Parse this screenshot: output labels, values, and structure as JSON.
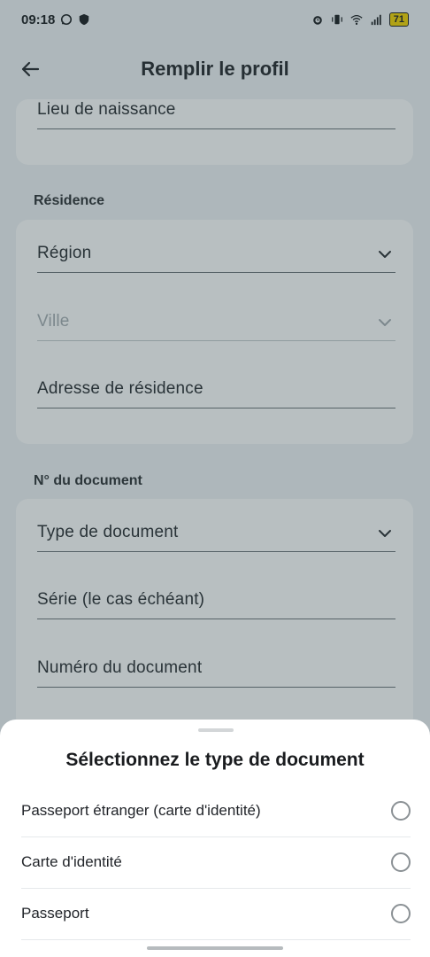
{
  "status_bar": {
    "time": "09:18",
    "battery": "71"
  },
  "app_bar": {
    "title": "Remplir le profil"
  },
  "form": {
    "birthplace_label": "Lieu de naissance",
    "residence_section": "Résidence",
    "region_label": "Région",
    "city_label": "Ville",
    "address_label": "Adresse de résidence",
    "document_section": "N° du document",
    "doc_type_label": "Type de document",
    "series_label": "Série (le cas échéant)",
    "doc_number_label": "Numéro du document"
  },
  "sheet": {
    "title": "Sélectionnez le type de document",
    "options": [
      {
        "label": "Passeport étranger (carte d'identité)"
      },
      {
        "label": "Carte d'identité"
      },
      {
        "label": "Passeport"
      }
    ]
  },
  "colors": {
    "accent_battery": "#f5d400",
    "overlay": "#284248"
  }
}
